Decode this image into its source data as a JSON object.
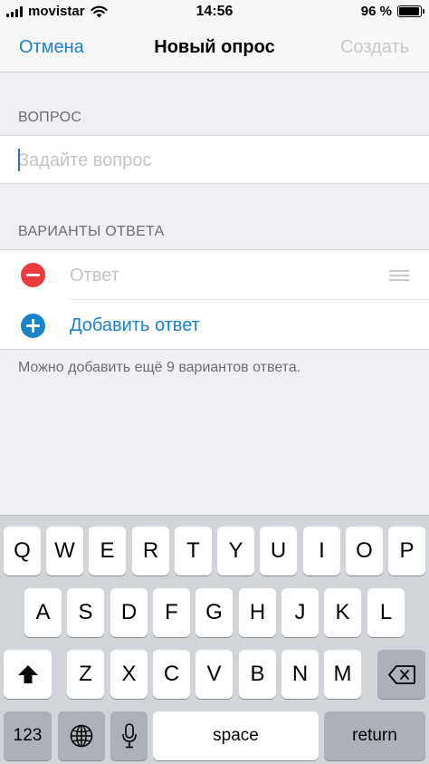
{
  "status_bar": {
    "carrier": "movistar",
    "time": "14:56",
    "battery_percent": "96 %",
    "battery_level": 0.96,
    "icons": [
      "signal-icon",
      "wifi-icon",
      "battery-icon"
    ]
  },
  "nav": {
    "cancel_label": "Отмена",
    "title": "Новый опрос",
    "create_label": "Создать"
  },
  "question_section": {
    "header": "ВОПРОС",
    "placeholder": "Задайте вопрос",
    "value": ""
  },
  "answers_section": {
    "header": "ВАРИАНТЫ ОТВЕТА",
    "answers": [
      {
        "placeholder": "Ответ",
        "value": ""
      }
    ],
    "add_label": "Добавить ответ",
    "footer_note": "Можно добавить ещё 9 вариантов ответа."
  },
  "keyboard": {
    "row1": [
      "Q",
      "W",
      "E",
      "R",
      "T",
      "Y",
      "U",
      "I",
      "O",
      "P"
    ],
    "row2": [
      "A",
      "S",
      "D",
      "F",
      "G",
      "H",
      "J",
      "K",
      "L"
    ],
    "row3": [
      "Z",
      "X",
      "C",
      "V",
      "B",
      "N",
      "M"
    ],
    "numbers_label": "123",
    "space_label": "space",
    "return_label": "return"
  },
  "colors": {
    "accent": "#1a82c9",
    "destructive": "#ee3c3c",
    "disabled": "#c7c7cc",
    "background": "#efeff4"
  }
}
